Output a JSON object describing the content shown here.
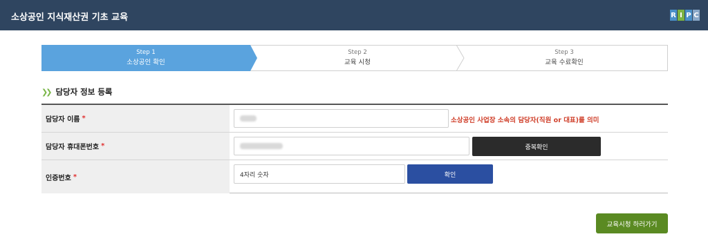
{
  "header": {
    "title": "소상공인 지식재산권 기초 교육",
    "logo_letters": [
      "R",
      "I",
      "P",
      "C"
    ],
    "logo_colors": [
      "#4a90c8",
      "#7cb342",
      "#4a90c8",
      "#8aa8c8"
    ]
  },
  "steps": [
    {
      "number": "Step 1",
      "label": "소상공인 확인",
      "active": true
    },
    {
      "number": "Step 2",
      "label": "교육 시청",
      "active": false
    },
    {
      "number": "Step 3",
      "label": "교육 수료확인",
      "active": false
    }
  ],
  "section": {
    "title": "담당자 정보 등록"
  },
  "form": {
    "required_mark": "*",
    "name_row": {
      "label": "담당자 이름",
      "hint": "소상공인 사업장 소속의 담당자(직원 or 대표)를 의미"
    },
    "phone_row": {
      "label": "담당자 휴대폰번호",
      "dup_check_button": "중복확인"
    },
    "auth_row": {
      "label": "인증번호",
      "placeholder": "4자리 숫자",
      "confirm_button": "확인"
    }
  },
  "submit_button": "교육시청 하러가기",
  "colors": {
    "header_bg": "#2f4560",
    "step_active": "#5aa3de",
    "required": "#e03030",
    "hint": "#d0402b",
    "dark_button": "#2b2b2b",
    "blue_button": "#2b4fa1",
    "green_button": "#5a8a22"
  }
}
